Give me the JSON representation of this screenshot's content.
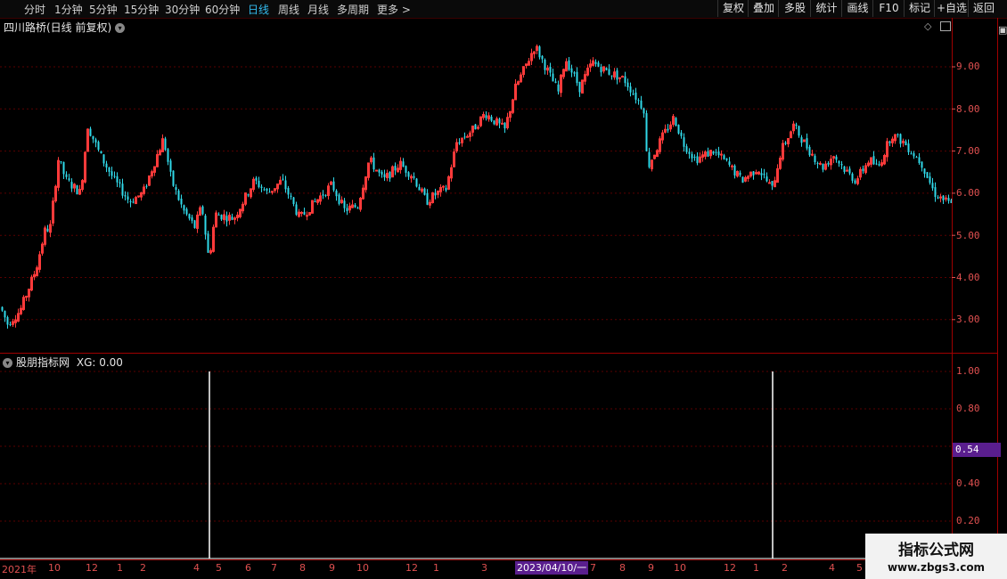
{
  "toolbar": {
    "timeframes": [
      "分时",
      "1分钟",
      "5分钟",
      "15分钟",
      "30分钟",
      "60分钟",
      "日线",
      "周线",
      "月线",
      "多周期",
      "更多 >"
    ],
    "active": "日线",
    "right_buttons": [
      "复权",
      "叠加",
      "多股",
      "统计",
      "画线",
      "F10",
      "标记",
      "+自选",
      "返回"
    ]
  },
  "main": {
    "title": "四川路桥(日线 前复权)",
    "y_labels": [
      "9.00",
      "8.00",
      "7.00",
      "6.00",
      "5.00",
      "4.00",
      "3.00"
    ]
  },
  "indicator": {
    "title": "股朋指标网",
    "value_text": "XG: 0.00",
    "y_labels": [
      "1.00",
      "0.80",
      "0.40",
      "0.20"
    ],
    "cursor_value": "0.54"
  },
  "x_axis": {
    "labels": [
      "2021年",
      "10",
      "12",
      "1",
      "2",
      "4",
      "5",
      "6",
      "7",
      "8",
      "9",
      "10",
      "12",
      "1",
      "3",
      "7",
      "8",
      "9",
      "10",
      "12",
      "1",
      "2",
      "4",
      "5"
    ],
    "cursor_date": "2023/04/10/一"
  },
  "watermark": {
    "line1": "指标公式网",
    "line2": "www.zbgs3.com"
  },
  "colors": {
    "up": "#ff3a3a",
    "down": "#30d8e8",
    "grid": "#5a0000",
    "axis": "#e05050"
  },
  "chart_data": {
    "type": "candlestick",
    "ylim": [
      2.3,
      9.9
    ],
    "signal_peaks": [
      1.0,
      1.0
    ],
    "anchors": [
      [
        0,
        3.3
      ],
      [
        8,
        2.9
      ],
      [
        22,
        3.2
      ],
      [
        40,
        4.2
      ],
      [
        50,
        5.1
      ],
      [
        56,
        5.2
      ],
      [
        65,
        6.8
      ],
      [
        74,
        6.3
      ],
      [
        90,
        6.0
      ],
      [
        98,
        7.6
      ],
      [
        112,
        6.9
      ],
      [
        128,
        6.3
      ],
      [
        145,
        5.8
      ],
      [
        160,
        6.0
      ],
      [
        183,
        7.3
      ],
      [
        192,
        6.3
      ],
      [
        205,
        5.6
      ],
      [
        218,
        5.2
      ],
      [
        226,
        5.7
      ],
      [
        234,
        4.4
      ],
      [
        241,
        5.5
      ],
      [
        262,
        5.4
      ],
      [
        285,
        6.3
      ],
      [
        300,
        6.0
      ],
      [
        316,
        6.3
      ],
      [
        336,
        5.4
      ],
      [
        358,
        5.9
      ],
      [
        372,
        6.2
      ],
      [
        386,
        5.6
      ],
      [
        401,
        5.7
      ],
      [
        414,
        6.8
      ],
      [
        430,
        6.3
      ],
      [
        448,
        6.7
      ],
      [
        463,
        6.4
      ],
      [
        478,
        5.8
      ],
      [
        490,
        6.0
      ],
      [
        500,
        6.1
      ],
      [
        512,
        7.2
      ],
      [
        530,
        7.5
      ],
      [
        544,
        7.9
      ],
      [
        566,
        7.5
      ],
      [
        578,
        8.5
      ],
      [
        600,
        9.5
      ],
      [
        614,
        8.9
      ],
      [
        626,
        8.4
      ],
      [
        634,
        9.2
      ],
      [
        650,
        8.5
      ],
      [
        664,
        9.1
      ],
      [
        680,
        8.9
      ],
      [
        700,
        8.7
      ],
      [
        722,
        8.0
      ],
      [
        726,
        6.6
      ],
      [
        742,
        7.3
      ],
      [
        756,
        7.8
      ],
      [
        766,
        7.2
      ],
      [
        780,
        6.8
      ],
      [
        800,
        7.0
      ],
      [
        816,
        6.7
      ],
      [
        832,
        6.3
      ],
      [
        850,
        6.6
      ],
      [
        866,
        6.1
      ],
      [
        876,
        7.0
      ],
      [
        890,
        7.6
      ],
      [
        905,
        7.1
      ],
      [
        922,
        6.6
      ],
      [
        935,
        6.9
      ],
      [
        950,
        6.5
      ],
      [
        960,
        6.3
      ],
      [
        975,
        6.8
      ],
      [
        985,
        6.6
      ],
      [
        1000,
        7.4
      ],
      [
        1014,
        7.2
      ],
      [
        1034,
        6.7
      ],
      [
        1048,
        6.0
      ],
      [
        1068,
        5.7
      ]
    ]
  }
}
